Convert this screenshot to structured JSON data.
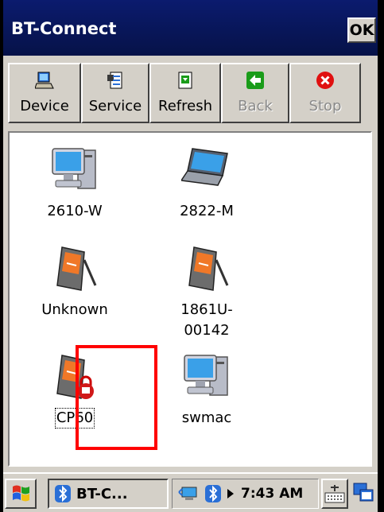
{
  "window": {
    "title": "BT-Connect",
    "ok_label": "OK"
  },
  "toolbar": [
    {
      "label": "Device",
      "icon": "device-icon",
      "enabled": true
    },
    {
      "label": "Service",
      "icon": "service-icon",
      "enabled": true
    },
    {
      "label": "Refresh",
      "icon": "refresh-icon",
      "enabled": true
    },
    {
      "label": "Back",
      "icon": "back-arrow-icon",
      "enabled": false
    },
    {
      "label": "Stop",
      "icon": "stop-icon",
      "enabled": false
    }
  ],
  "devices": [
    {
      "name": "2610-W",
      "icon": "desktop-computer-icon"
    },
    {
      "name": "2822-M",
      "icon": "laptop-icon"
    },
    {
      "name": "Unknown",
      "icon": "pda-icon"
    },
    {
      "name": "1861U-\n00142",
      "icon": "pda-icon"
    },
    {
      "name": "CP60",
      "icon": "pda-locked-icon",
      "selected": true
    },
    {
      "name": "swmac",
      "icon": "desktop-computer-icon"
    }
  ],
  "taskbar": {
    "task_label": "BT-C...",
    "clock": "7:43 AM"
  },
  "colors": {
    "title_bar": "#061248",
    "highlight": "#ff0000",
    "back_green": "#1a9c1a",
    "stop_red": "#e01010"
  }
}
